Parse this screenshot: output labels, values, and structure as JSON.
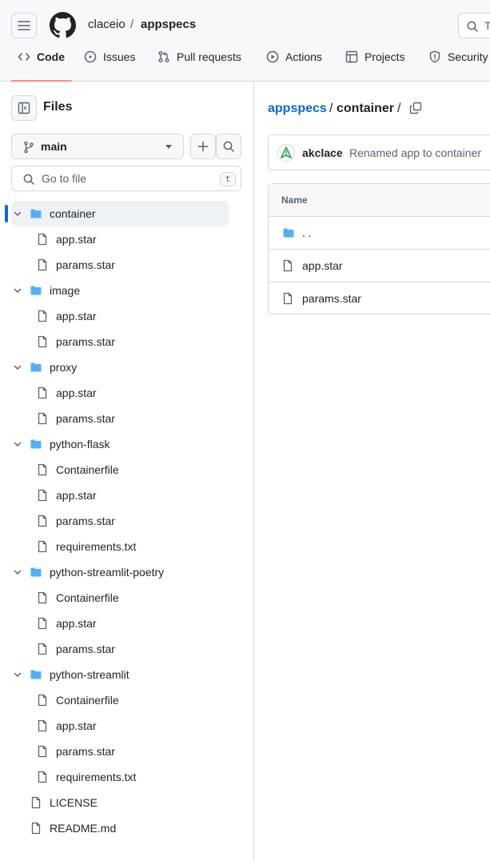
{
  "header": {
    "owner": "claceio",
    "separator": "/",
    "repo": "appspecs",
    "search_text": "T"
  },
  "tabs": [
    {
      "label": "Code",
      "icon": "code-icon",
      "active": true
    },
    {
      "label": "Issues",
      "icon": "issue-opened-icon"
    },
    {
      "label": "Pull requests",
      "icon": "git-pull-request-icon"
    },
    {
      "label": "Actions",
      "icon": "play-icon"
    },
    {
      "label": "Projects",
      "icon": "table-icon"
    },
    {
      "label": "Security",
      "icon": "shield-icon"
    }
  ],
  "sidebar": {
    "title": "Files",
    "branch": "main",
    "goto_placeholder": "Go to file",
    "goto_shortcut": "t",
    "tree": [
      {
        "type": "dir",
        "name": "container",
        "depth": 0,
        "selected": true
      },
      {
        "type": "file",
        "name": "app.star",
        "depth": 1
      },
      {
        "type": "file",
        "name": "params.star",
        "depth": 1
      },
      {
        "type": "dir",
        "name": "image",
        "depth": 0
      },
      {
        "type": "file",
        "name": "app.star",
        "depth": 1
      },
      {
        "type": "file",
        "name": "params.star",
        "depth": 1
      },
      {
        "type": "dir",
        "name": "proxy",
        "depth": 0
      },
      {
        "type": "file",
        "name": "app.star",
        "depth": 1
      },
      {
        "type": "file",
        "name": "params.star",
        "depth": 1
      },
      {
        "type": "dir",
        "name": "python-flask",
        "depth": 0
      },
      {
        "type": "file",
        "name": "Containerfile",
        "depth": 1
      },
      {
        "type": "file",
        "name": "app.star",
        "depth": 1
      },
      {
        "type": "file",
        "name": "params.star",
        "depth": 1
      },
      {
        "type": "file",
        "name": "requirements.txt",
        "depth": 1
      },
      {
        "type": "dir",
        "name": "python-streamlit-poetry",
        "depth": 0
      },
      {
        "type": "file",
        "name": "Containerfile",
        "depth": 1
      },
      {
        "type": "file",
        "name": "app.star",
        "depth": 1
      },
      {
        "type": "file",
        "name": "params.star",
        "depth": 1
      },
      {
        "type": "dir",
        "name": "python-streamlit",
        "depth": 0
      },
      {
        "type": "file",
        "name": "Containerfile",
        "depth": 1
      },
      {
        "type": "file",
        "name": "app.star",
        "depth": 1
      },
      {
        "type": "file",
        "name": "params.star",
        "depth": 1
      },
      {
        "type": "file",
        "name": "requirements.txt",
        "depth": 1
      },
      {
        "type": "file",
        "name": "LICENSE",
        "depth": 0
      },
      {
        "type": "file",
        "name": "README.md",
        "depth": 0
      }
    ]
  },
  "main": {
    "breadcrumb": {
      "owner": "appspecs",
      "sep": "/",
      "dir": "container",
      "trail": "/"
    },
    "commit": {
      "author": "akclace",
      "message": "Renamed app to container"
    },
    "table": {
      "header": "Name",
      "rows": [
        {
          "type": "dir",
          "name": ". ."
        },
        {
          "type": "file",
          "name": "app.star"
        },
        {
          "type": "file",
          "name": "params.star"
        }
      ]
    }
  },
  "colors": {
    "link": "#0969da",
    "folder": "#54aeff",
    "tab_underline": "#fd8c73",
    "muted": "#59636e"
  }
}
